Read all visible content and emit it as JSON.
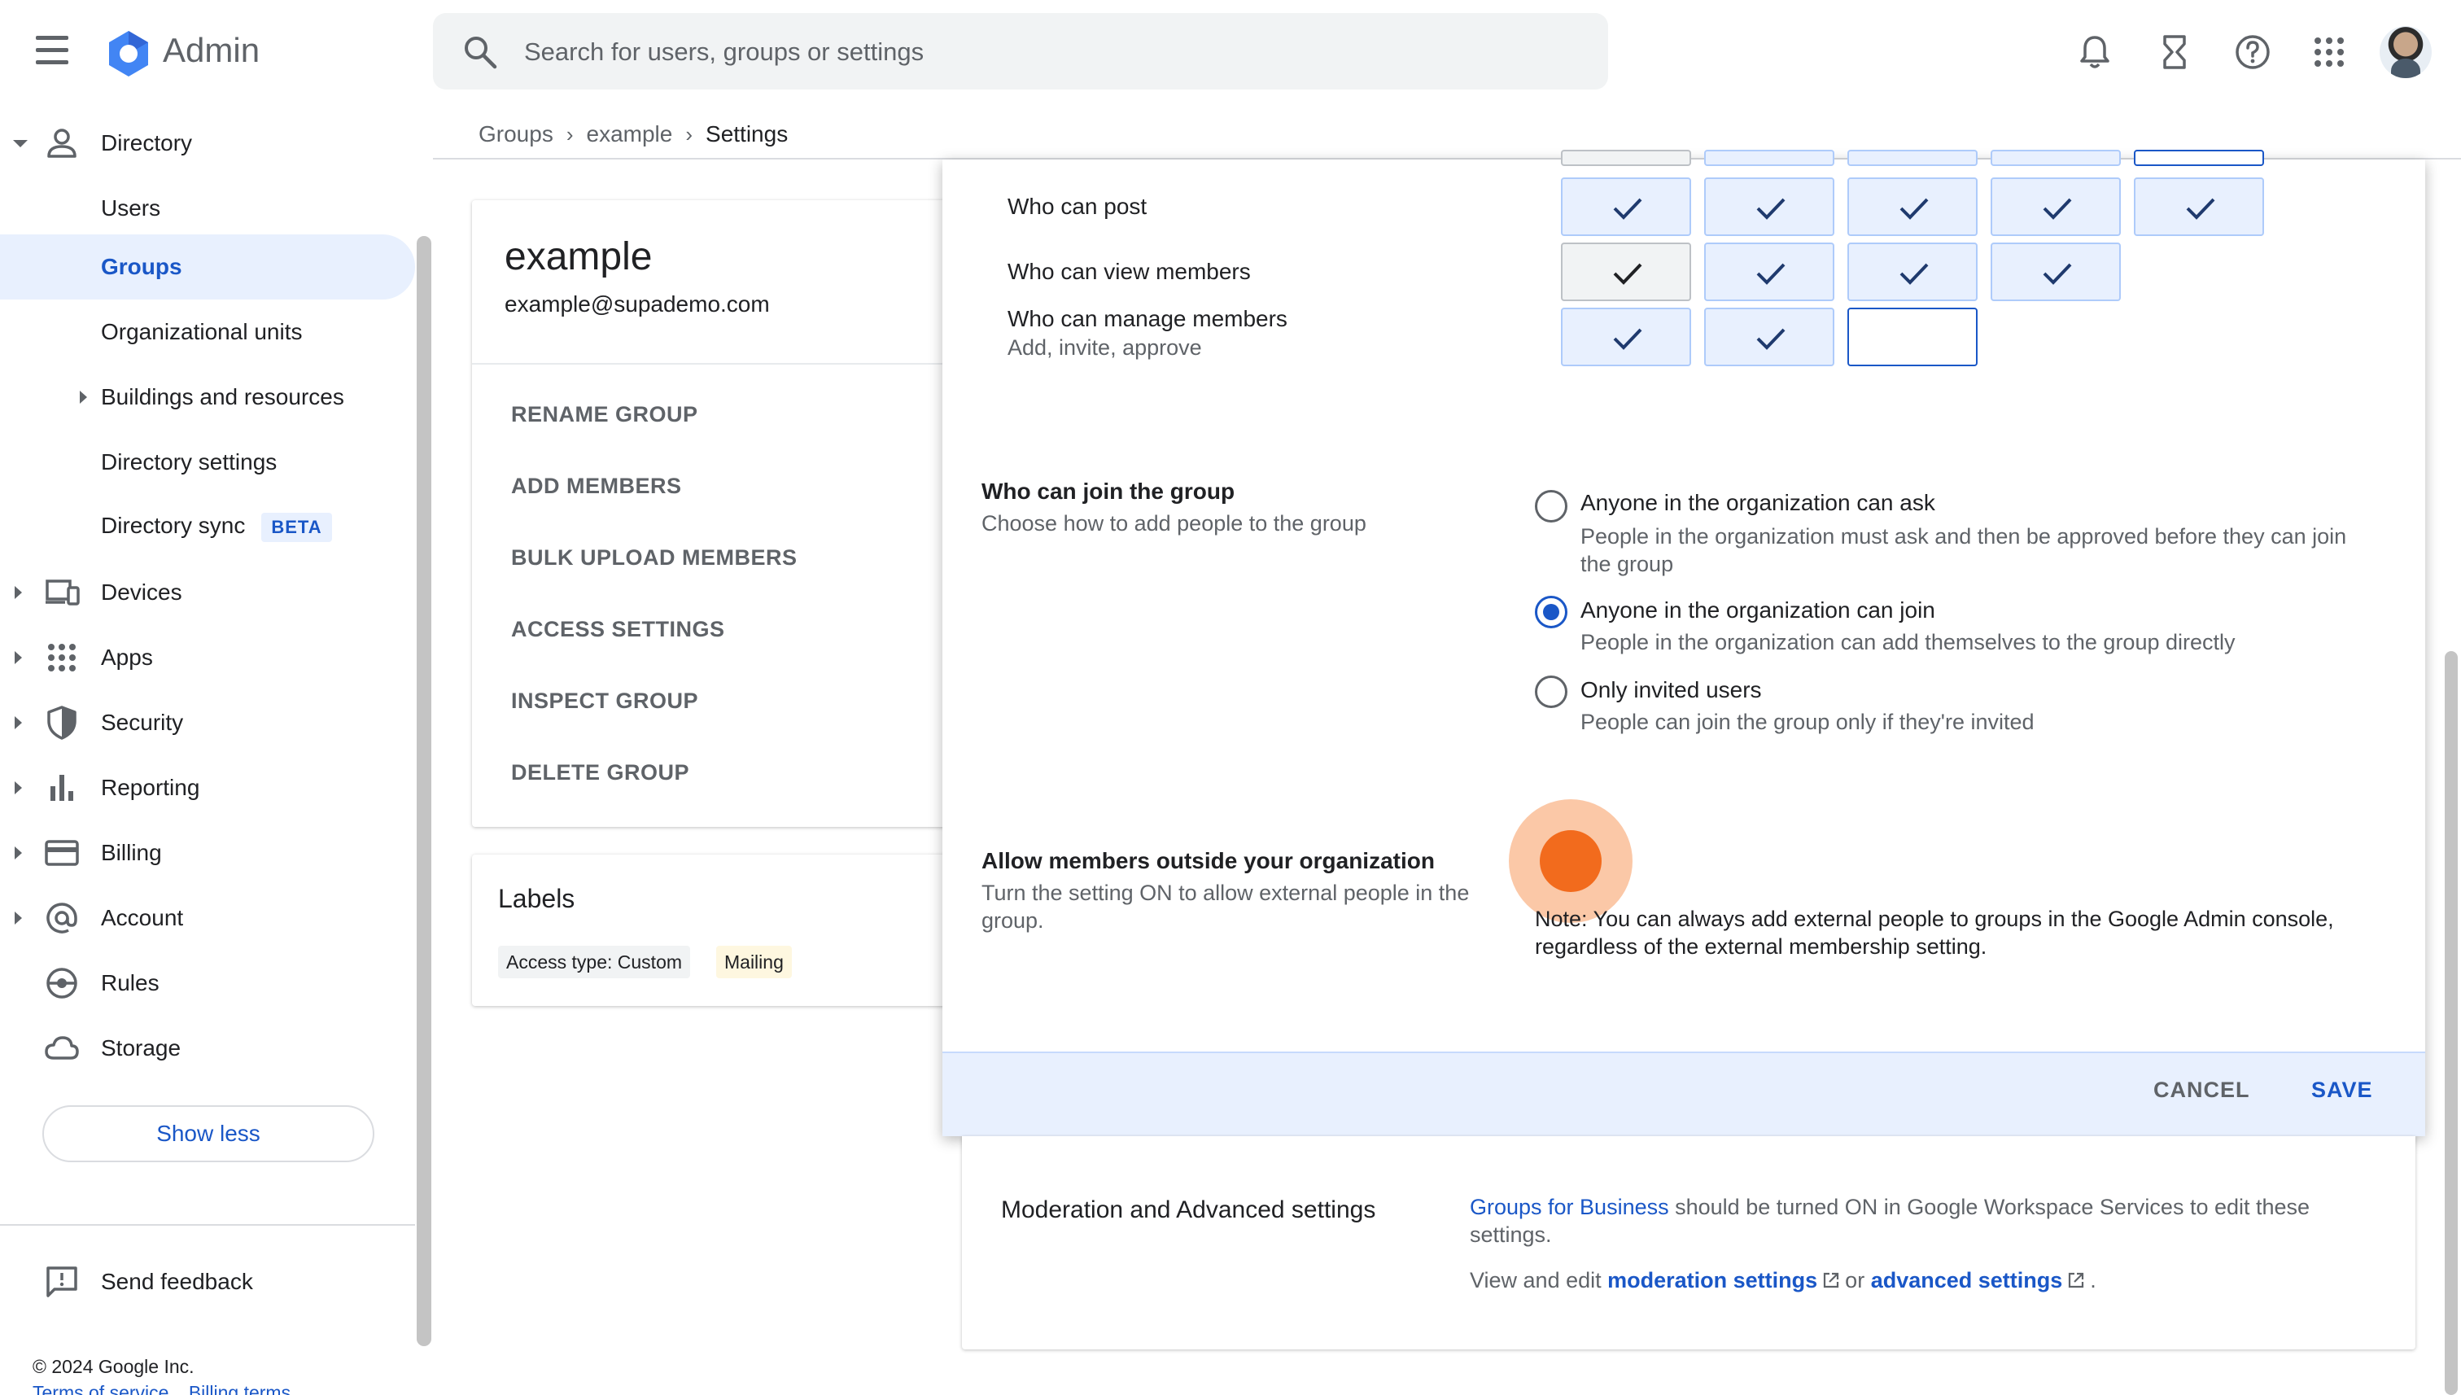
{
  "app": {
    "title": "Admin"
  },
  "search": {
    "placeholder": "Search for users, groups or settings"
  },
  "breadcrumb": {
    "items": [
      "Groups",
      "example",
      "Settings"
    ]
  },
  "sidebar": {
    "directory": "Directory",
    "users": "Users",
    "groups": "Groups",
    "org_units": "Organizational units",
    "buildings": "Buildings and resources",
    "dir_settings": "Directory settings",
    "dir_sync": "Directory sync",
    "beta": "BETA",
    "devices": "Devices",
    "apps": "Apps",
    "security": "Security",
    "reporting": "Reporting",
    "billing": "Billing",
    "account": "Account",
    "rules": "Rules",
    "storage": "Storage",
    "show_less": "Show less",
    "send_feedback": "Send feedback",
    "copyright": "© 2024 Google Inc.",
    "terms": "Terms of service",
    "billing_terms": "Billing terms"
  },
  "group": {
    "name": "example",
    "email": "example@supademo.com",
    "actions": [
      "RENAME GROUP",
      "ADD MEMBERS",
      "BULK UPLOAD MEMBERS",
      "ACCESS SETTINGS",
      "INSPECT GROUP",
      "DELETE GROUP"
    ]
  },
  "labels": {
    "title": "Labels",
    "chips": [
      "Access type: Custom",
      "Mailing"
    ]
  },
  "permissions": {
    "who_can_post": "Who can post",
    "who_can_view_members": "Who can view members",
    "who_can_manage_members": "Who can manage members",
    "manage_sub": "Add, invite, approve"
  },
  "join": {
    "title": "Who can join the group",
    "subtitle": "Choose how to add people to the group",
    "options": [
      {
        "label": "Anyone in the organization can ask",
        "desc": "People in the organization must ask and then be approved before they can join the group",
        "selected": false
      },
      {
        "label": "Anyone in the organization can join",
        "desc": "People in the organization can add themselves to the group directly",
        "selected": true
      },
      {
        "label": "Only invited users",
        "desc": "People can join the group only if they're invited",
        "selected": false
      }
    ]
  },
  "external": {
    "title": "Allow members outside your organization",
    "subtitle": "Turn the setting ON to allow external people in the group.",
    "note_label": "Note:",
    "note_text": "You can always add external people to groups in the Google Admin console, regardless of the external membership setting."
  },
  "dialog": {
    "cancel": "CANCEL",
    "save": "SAVE"
  },
  "moderation": {
    "title": "Moderation and Advanced settings",
    "link_groups": "Groups for Business",
    "text_after": "should be turned ON in Google Workspace Services to edit these settings.",
    "view_prefix": "View and edit",
    "moderation_link": "moderation settings",
    "or": "or",
    "advanced_link": "advanced settings",
    "period": "."
  },
  "colors": {
    "accent": "#1a57c7",
    "highlight": "#e8f0fe",
    "toggle": "#f26b1d"
  }
}
